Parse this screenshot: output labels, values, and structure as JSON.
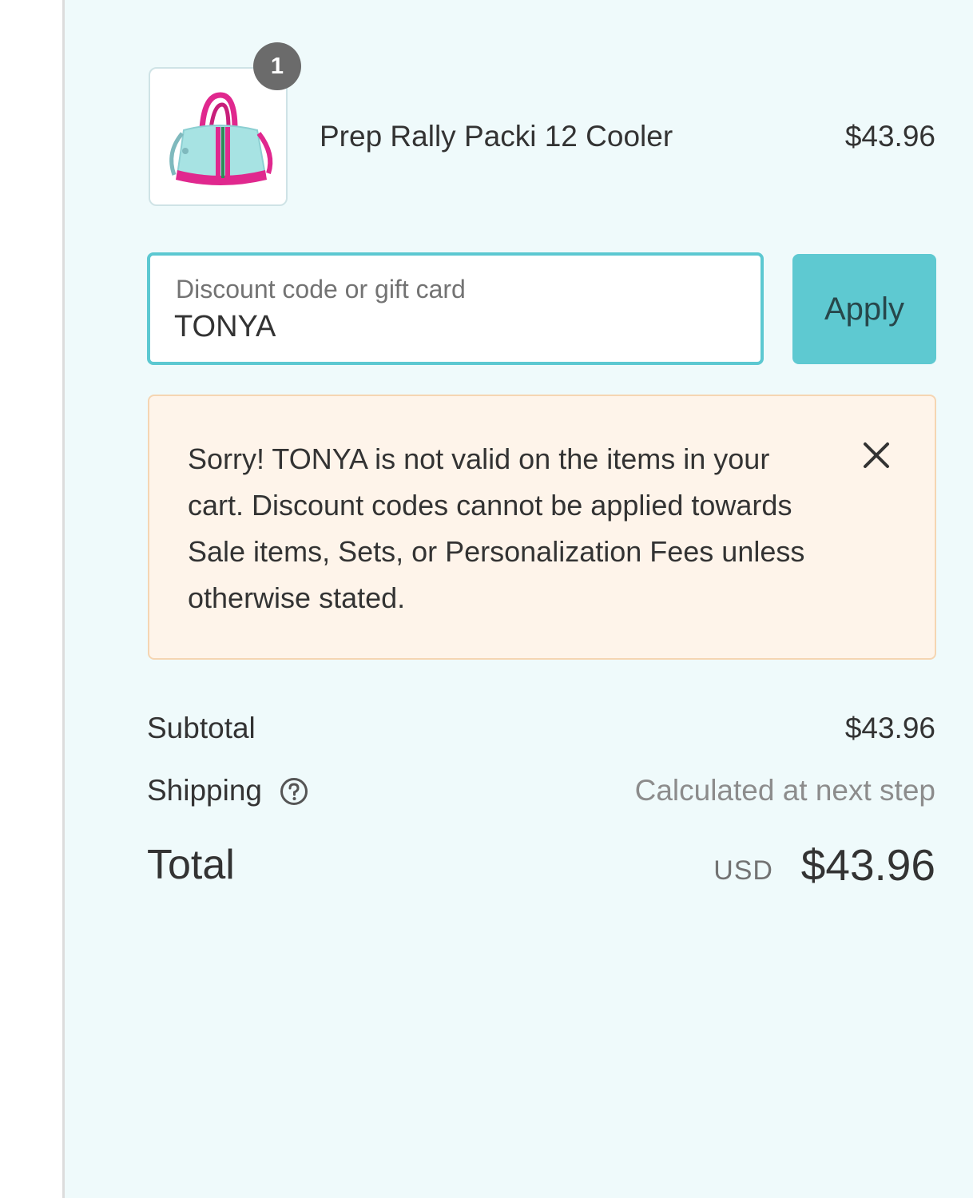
{
  "order_summary": {
    "item": {
      "name": "Prep Rally Packi 12 Cooler",
      "price": "$43.96",
      "quantity": "1",
      "image_icon": "cooler-bag-icon"
    },
    "discount": {
      "label": "Discount code or gift card",
      "value": "TONYA",
      "apply_label": "Apply"
    },
    "error": {
      "message": "Sorry! TONYA is not valid on the items in your cart. Discount codes cannot be applied towards Sale items, Sets, or Personalization Fees unless otherwise stated.",
      "close_icon": "close-icon"
    },
    "subtotal": {
      "label": "Subtotal",
      "value": "$43.96"
    },
    "shipping": {
      "label": "Shipping",
      "value": "Calculated at next step",
      "help_icon": "question-circle-icon"
    },
    "total": {
      "label": "Total",
      "currency": "USD",
      "value": "$43.96"
    }
  },
  "colors": {
    "summary_background": "#effafb",
    "accent": "#5ec9d1",
    "error_background": "#fef4ea",
    "error_border": "#f5d5b2",
    "text": "#333333",
    "muted": "#8c8c8c"
  }
}
